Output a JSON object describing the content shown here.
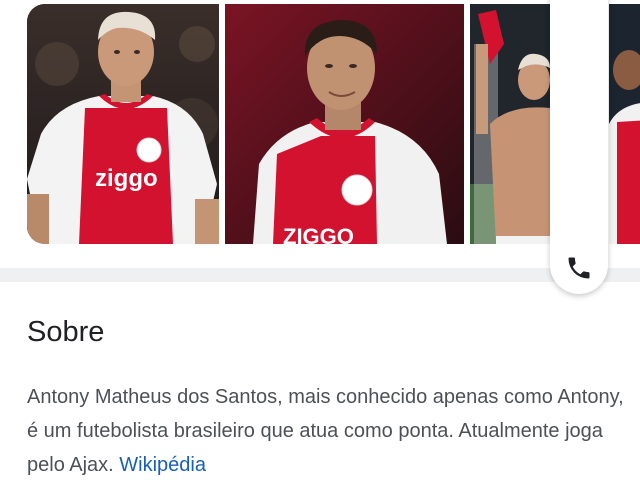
{
  "carousel": {
    "images": [
      {
        "alt": "Antony - foto 1",
        "jersey_text": "ziggo"
      },
      {
        "alt": "Antony - foto 2",
        "jersey_text": "ZIGGO"
      },
      {
        "alt": "Antony - foto 3",
        "jersey_text": ""
      },
      {
        "alt": "Antony - foto 4",
        "jersey_text": ""
      }
    ]
  },
  "actions": {
    "phone_icon": "phone-icon"
  },
  "about": {
    "title": "Sobre",
    "description": "Antony Matheus dos Santos, mais conhecido apenas como Antony, é um futebolista brasileiro que atua como ponta. Atualmente joga pelo Ajax.",
    "source_link": "Wikipédia"
  },
  "colors": {
    "link": "#1a5fb4",
    "title": "#202124",
    "body_text": "#4d5156",
    "ajax_red": "#d2122e",
    "separator": "#eef0f2"
  }
}
